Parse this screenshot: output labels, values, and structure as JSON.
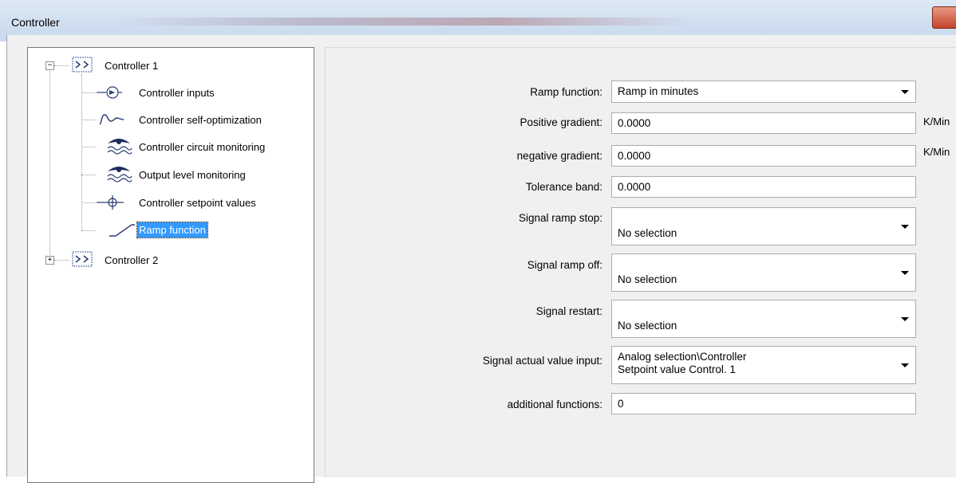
{
  "window": {
    "title": "Controller"
  },
  "tree": {
    "nodes": [
      {
        "label": "Controller 1",
        "expander": "−",
        "icon": "controller-icon"
      },
      {
        "label": "Controller inputs",
        "icon": "input-icon"
      },
      {
        "label": "Controller self-optimization",
        "icon": "wave-icon"
      },
      {
        "label": "Controller circuit monitoring",
        "icon": "eye-wave-icon"
      },
      {
        "label": "Output level monitoring",
        "icon": "eye-wave-icon"
      },
      {
        "label": "Controller setpoint values",
        "icon": "crosshair-icon"
      },
      {
        "label": "Ramp function",
        "icon": "ramp-icon",
        "selected": true
      },
      {
        "label": "Controller 2",
        "expander": "+",
        "icon": "controller-icon"
      }
    ]
  },
  "form": {
    "ramp_function": {
      "label": "Ramp function:",
      "value": "Ramp in minutes"
    },
    "positive_gradient": {
      "label": "Positive gradient:",
      "value": "0.0000",
      "unit": "K/Min"
    },
    "negative_gradient": {
      "label": "negative gradient:",
      "value": "0.0000",
      "unit": "K/Min"
    },
    "tolerance_band": {
      "label": "Tolerance band:",
      "value": "0.0000"
    },
    "signal_ramp_stop": {
      "label": "Signal ramp stop:",
      "value": "No selection"
    },
    "signal_ramp_off": {
      "label": "Signal ramp off:",
      "value": "No selection"
    },
    "signal_restart": {
      "label": "Signal restart:",
      "value": "No selection"
    },
    "signal_actual_value_input": {
      "label": "Signal actual value input:",
      "value_line1": "Analog selection\\Controller",
      "value_line2": "Setpoint value Control. 1"
    },
    "additional_functions": {
      "label": "additional functions:",
      "value": "0"
    }
  }
}
